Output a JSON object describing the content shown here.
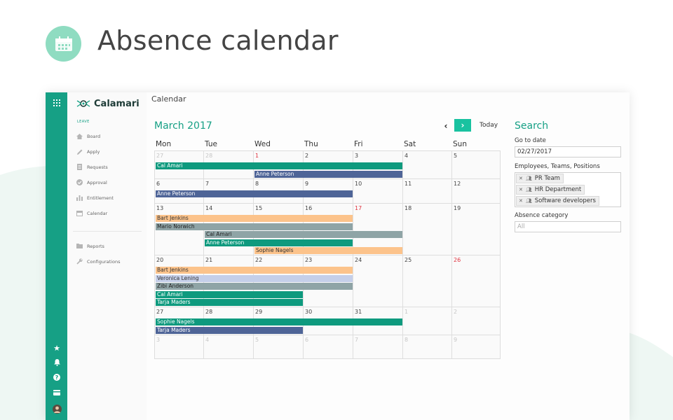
{
  "hero": {
    "title": "Absence calendar",
    "icon": "calendar-icon"
  },
  "app": {
    "brand": "Calamari",
    "header": "Calendar",
    "accent": "#16a085"
  },
  "rail": [
    "apps-grid-icon",
    "star-icon",
    "bell-icon",
    "help-icon",
    "card-icon",
    "avatar"
  ],
  "sidebar": {
    "section": "LEAVE",
    "items": [
      {
        "label": "Board",
        "icon": "home-icon"
      },
      {
        "label": "Apply",
        "icon": "pencil-icon"
      },
      {
        "label": "Requests",
        "icon": "document-icon"
      },
      {
        "label": "Approval",
        "icon": "check-icon"
      },
      {
        "label": "Entitlement",
        "icon": "bars-icon"
      },
      {
        "label": "Calendar",
        "icon": "calendar-icon"
      }
    ],
    "bottom_items": [
      {
        "label": "Reports",
        "icon": "folder-icon"
      },
      {
        "label": "Configurations",
        "icon": "wrench-icon"
      }
    ]
  },
  "calendar": {
    "month": "March 2017",
    "today_label": "Today",
    "weekdays": [
      "Mon",
      "Tue",
      "Wed",
      "Thu",
      "Fri",
      "Sat",
      "Sun"
    ],
    "weeks": [
      [
        {
          "d": "27",
          "muted": true
        },
        {
          "d": "28",
          "muted": true
        },
        {
          "d": "1",
          "red": true
        },
        {
          "d": "2"
        },
        {
          "d": "3"
        },
        {
          "d": "4"
        },
        {
          "d": "5"
        }
      ],
      [
        {
          "d": "6"
        },
        {
          "d": "7"
        },
        {
          "d": "8"
        },
        {
          "d": "9"
        },
        {
          "d": "10"
        },
        {
          "d": "11"
        },
        {
          "d": "12"
        }
      ],
      [
        {
          "d": "13"
        },
        {
          "d": "14"
        },
        {
          "d": "15"
        },
        {
          "d": "16"
        },
        {
          "d": "17",
          "red": true
        },
        {
          "d": "18"
        },
        {
          "d": "19"
        }
      ],
      [
        {
          "d": "20"
        },
        {
          "d": "21"
        },
        {
          "d": "22"
        },
        {
          "d": "23"
        },
        {
          "d": "24"
        },
        {
          "d": "25"
        },
        {
          "d": "26",
          "red": true
        }
      ],
      [
        {
          "d": "27"
        },
        {
          "d": "28"
        },
        {
          "d": "29"
        },
        {
          "d": "30"
        },
        {
          "d": "31"
        },
        {
          "d": "1",
          "muted": true
        },
        {
          "d": "2",
          "muted": true
        }
      ],
      [
        {
          "d": "3",
          "muted": true
        },
        {
          "d": "4",
          "muted": true
        },
        {
          "d": "5",
          "muted": true
        },
        {
          "d": "6",
          "muted": true
        },
        {
          "d": "7",
          "muted": true
        },
        {
          "d": "8",
          "muted": true
        },
        {
          "d": "9",
          "muted": true
        }
      ]
    ],
    "events": [
      {
        "name": "Cal Amari",
        "week": 0,
        "start": 0,
        "span": 5,
        "slot": 0,
        "color": "green"
      },
      {
        "name": "Anne Peterson",
        "week": 0,
        "start": 2,
        "span": 3,
        "slot": 1,
        "color": "navy"
      },
      {
        "name": "Anne Peterson",
        "week": 1,
        "start": 0,
        "span": 4,
        "slot": 0,
        "color": "navy"
      },
      {
        "name": "Bart Jenkins",
        "week": 2,
        "start": 0,
        "span": 4,
        "slot": 0,
        "color": "peach"
      },
      {
        "name": "Mario Norwich",
        "week": 2,
        "start": 0,
        "span": 4,
        "slot": 1,
        "color": "gray"
      },
      {
        "name": "Cal Amari",
        "week": 2,
        "start": 1,
        "span": 4,
        "slot": 2,
        "color": "gray"
      },
      {
        "name": "Anne Peterson",
        "week": 2,
        "start": 1,
        "span": 3,
        "slot": 3,
        "color": "green"
      },
      {
        "name": "Sophie Nagels",
        "week": 2,
        "start": 2,
        "span": 3,
        "slot": 4,
        "color": "peach"
      },
      {
        "name": "Bart Jenkins",
        "week": 3,
        "start": 0,
        "span": 4,
        "slot": 0,
        "color": "peach"
      },
      {
        "name": "Veronica Lening",
        "week": 3,
        "start": 0,
        "span": 4,
        "slot": 1,
        "color": "lilac"
      },
      {
        "name": "Zibi Anderson",
        "week": 3,
        "start": 0,
        "span": 4,
        "slot": 2,
        "color": "gray"
      },
      {
        "name": "Cal Amari",
        "week": 3,
        "start": 0,
        "span": 3,
        "slot": 3,
        "color": "green"
      },
      {
        "name": "Tarja Maders",
        "week": 3,
        "start": 0,
        "span": 3,
        "slot": 4,
        "color": "green"
      },
      {
        "name": "Sophie Nagels",
        "week": 4,
        "start": 0,
        "span": 5,
        "slot": 0,
        "color": "green"
      },
      {
        "name": "Tarja Maders",
        "week": 4,
        "start": 0,
        "span": 3,
        "slot": 1,
        "color": "navy"
      }
    ]
  },
  "search": {
    "title": "Search",
    "go_to_date_label": "Go to date",
    "go_to_date_value": "02/27/2017",
    "filter_label": "Employees, Teams, Positions",
    "filters": [
      "PR Team",
      "HR Department",
      "Software developers"
    ],
    "category_label": "Absence category",
    "category_placeholder": "All"
  }
}
